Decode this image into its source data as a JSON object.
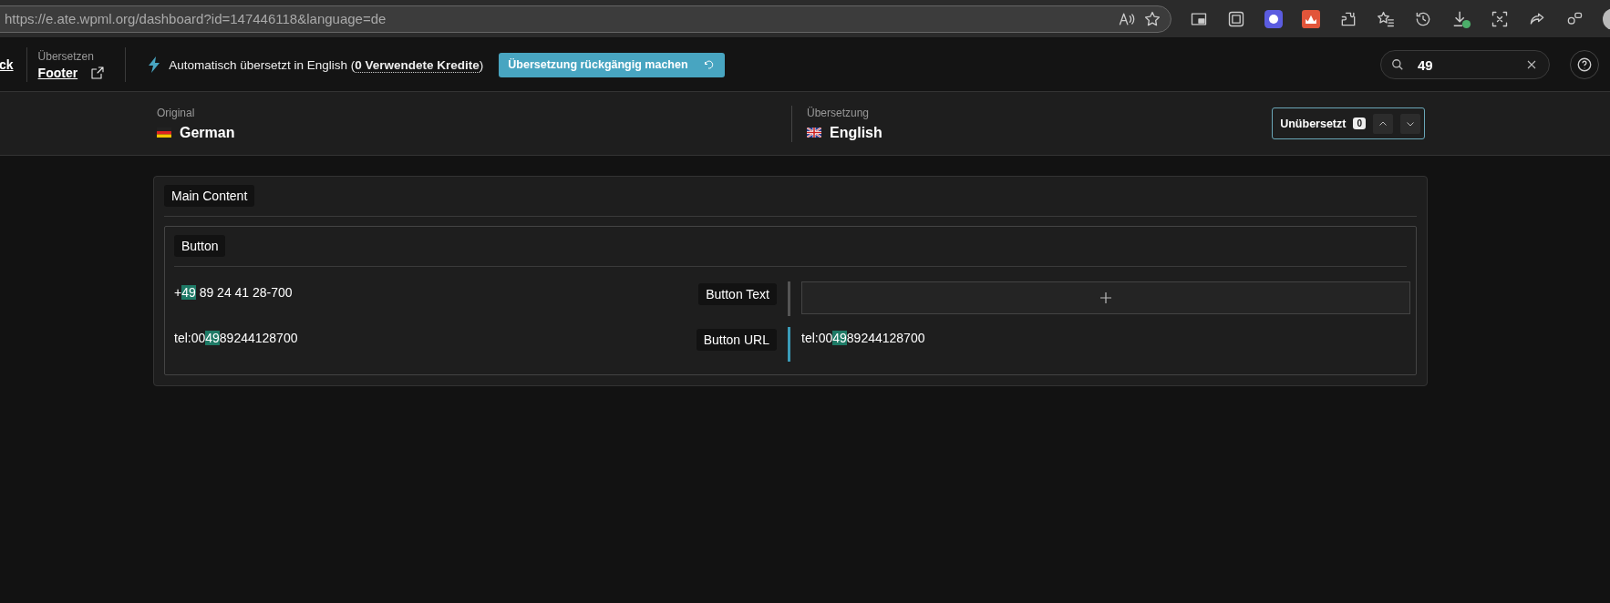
{
  "browser": {
    "url": "https://e.ate.wpml.org/dashboard?id=147446118&language=de"
  },
  "header": {
    "back_link": "ck",
    "section_label": "Übersetzen",
    "document_link": "Footer",
    "status_text": "Automatisch übersetzt in English (",
    "credits_link": "0 Verwendete Kredite",
    "status_end": ")",
    "undo_button": "Übersetzung rückgängig machen",
    "search": {
      "value": "49"
    }
  },
  "languages": {
    "source_label": "Original",
    "source": "German",
    "target_label": "Übersetzung",
    "target": "English",
    "filter": {
      "label": "Unübersetzt",
      "count": "0"
    }
  },
  "section": {
    "title": "Main Content",
    "group": {
      "title": "Button",
      "rows": [
        {
          "label": "Button Text",
          "translated": false,
          "source": [
            {
              "text": "+",
              "highlighted": false
            },
            {
              "text": "49",
              "highlighted": true
            },
            {
              "text": " 89 24 41 28-700",
              "highlighted": false
            }
          ],
          "translation": {
            "kind": "add"
          }
        },
        {
          "label": "Button URL",
          "translated": true,
          "source": [
            {
              "text": "tel:00",
              "highlighted": false
            },
            {
              "text": "49",
              "highlighted": true
            },
            {
              "text": "89244128700",
              "highlighted": false
            }
          ],
          "translation": {
            "kind": "text",
            "segments": [
              {
                "text": "tel:00",
                "highlighted": false
              },
              {
                "text": "49",
                "highlighted": true
              },
              {
                "text": "89244128700",
                "highlighted": false
              }
            ]
          }
        }
      ]
    }
  }
}
